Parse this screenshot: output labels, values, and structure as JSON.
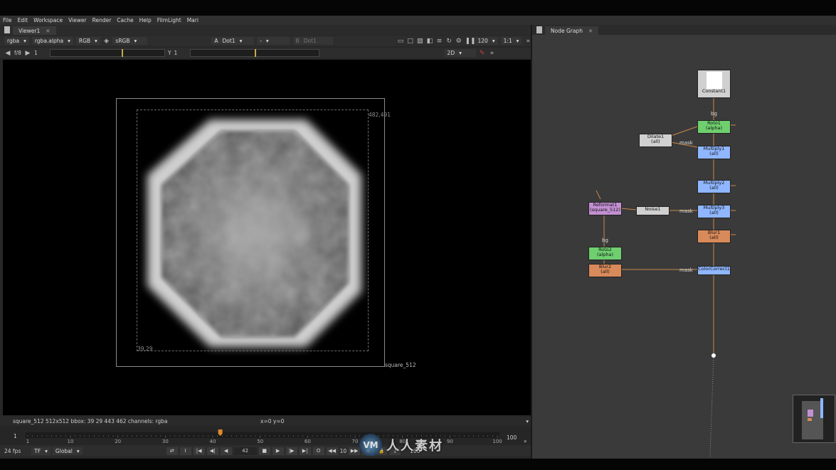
{
  "menu": [
    "File",
    "Edit",
    "Workspace",
    "Viewer",
    "Render",
    "Cache",
    "Help",
    "FilmLight",
    "Mari"
  ],
  "viewer": {
    "tab": "Viewer1",
    "channels": "rgba",
    "channel_alpha": "rgba.alpha",
    "display": "RGB",
    "lut": "sRGB",
    "input_a_label": "A",
    "input_a": "Dot1",
    "compare_op": "-",
    "input_b_label": "B",
    "input_b": "Dot1",
    "zoom_res": "120",
    "scale": "1:1",
    "fstop": "f/8",
    "gain": "1",
    "gamma_label": "Y",
    "gamma": "1",
    "mode_2d": "2D",
    "format_label": "square_512",
    "bbox_top_right": "482,491",
    "bbox_bottom_left": "39,29",
    "status_left": "square_512 512x512  bbox: 39 29 443 462 channels: rgba",
    "status_coords": "x=0 y=0"
  },
  "timeline": {
    "start": "1",
    "end_field": "100",
    "ticks": [
      "1",
      "10",
      "20",
      "30",
      "40",
      "50",
      "60",
      "70",
      "80",
      "90",
      "100"
    ],
    "current_frame": "42",
    "current_frame_fraction": 0.41,
    "fps": "24 fps",
    "tf": "TF",
    "range_mode": "Global",
    "step": "10",
    "end_field2": "100"
  },
  "node_graph": {
    "tab": "Node Graph",
    "nodes": {
      "constant1": "Constant1",
      "roto1": [
        "Roto1",
        "(alpha)"
      ],
      "dilate1": [
        "Dilate1",
        "(all)"
      ],
      "multiply1": [
        "Multiply1",
        "(all)"
      ],
      "multiply2": [
        "Multiply2",
        "(all)"
      ],
      "reformat1": [
        "Reformat1",
        "(square_512)"
      ],
      "noise1": "Noise1",
      "multiply3": [
        "Multiply3",
        "(all)"
      ],
      "blur1": [
        "Blur1",
        "(all)"
      ],
      "roto2": [
        "Roto2",
        "(alpha)"
      ],
      "blur2": [
        "Blur2",
        "(all)"
      ],
      "colorcorrect1": "ColorCorrect1"
    },
    "edge_labels": {
      "bg1": "bg",
      "mask1": "mask",
      "mask2": "mask",
      "bg2": "bg",
      "mask3": "mask"
    }
  },
  "watermark": {
    "logo": "VM",
    "text": "人人素材"
  },
  "colors": {
    "node_green": "#6fcf6f",
    "node_blue": "#8fb6ff",
    "node_orange": "#d98a5a",
    "node_purple": "#c38fd3",
    "node_gray": "#d0d0d0",
    "pipe": "#c8884a",
    "frame_marker": "#e0892a"
  }
}
